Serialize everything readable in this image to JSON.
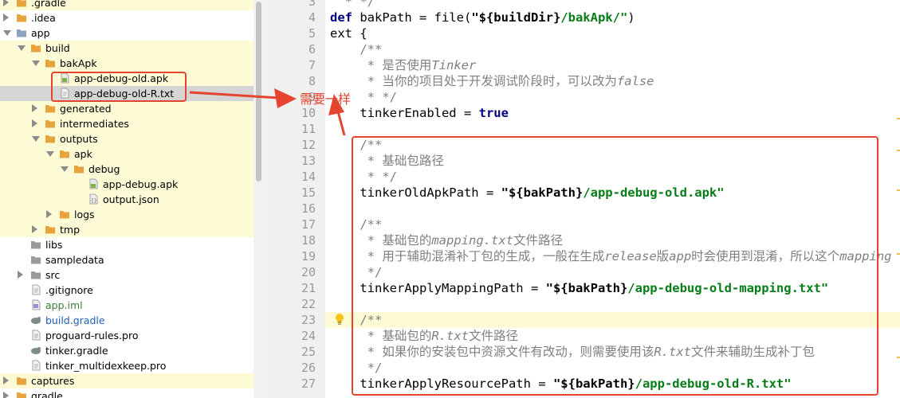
{
  "tree": {
    "items": [
      {
        "label": ".gradle",
        "indent": 0,
        "state": "collapsed",
        "icon": "folder-icon",
        "style": "normal",
        "highlight": true
      },
      {
        "label": ".idea",
        "indent": 0,
        "state": "collapsed",
        "icon": "folder-icon",
        "style": "normal",
        "highlight": false
      },
      {
        "label": "app",
        "indent": 0,
        "state": "expanded",
        "icon": "module-folder-icon",
        "style": "normal",
        "highlight": false
      },
      {
        "label": "build",
        "indent": 1,
        "state": "expanded",
        "icon": "folder-icon",
        "style": "normal",
        "highlight": true
      },
      {
        "label": "bakApk",
        "indent": 2,
        "state": "expanded",
        "icon": "folder-icon",
        "style": "normal",
        "highlight": true
      },
      {
        "label": "app-debug-old.apk",
        "indent": 3,
        "state": "leaf",
        "icon": "apk-file-icon",
        "style": "normal",
        "highlight": true
      },
      {
        "label": "app-debug-old-R.txt",
        "indent": 3,
        "state": "leaf",
        "icon": "text-file-icon",
        "style": "normal",
        "highlight": false,
        "selected": true
      },
      {
        "label": "generated",
        "indent": 2,
        "state": "collapsed",
        "icon": "folder-icon",
        "style": "normal",
        "highlight": true
      },
      {
        "label": "intermediates",
        "indent": 2,
        "state": "collapsed",
        "icon": "folder-icon",
        "style": "normal",
        "highlight": true
      },
      {
        "label": "outputs",
        "indent": 2,
        "state": "expanded",
        "icon": "folder-icon",
        "style": "normal",
        "highlight": true
      },
      {
        "label": "apk",
        "indent": 3,
        "state": "expanded",
        "icon": "folder-icon",
        "style": "normal",
        "highlight": true
      },
      {
        "label": "debug",
        "indent": 4,
        "state": "expanded",
        "icon": "folder-icon",
        "style": "normal",
        "highlight": true
      },
      {
        "label": "app-debug.apk",
        "indent": 5,
        "state": "leaf",
        "icon": "apk-file-icon",
        "style": "normal",
        "highlight": true
      },
      {
        "label": "output.json",
        "indent": 5,
        "state": "leaf",
        "icon": "json-file-icon",
        "style": "normal",
        "highlight": true
      },
      {
        "label": "logs",
        "indent": 3,
        "state": "collapsed",
        "icon": "folder-icon",
        "style": "normal",
        "highlight": true
      },
      {
        "label": "tmp",
        "indent": 2,
        "state": "collapsed",
        "icon": "folder-icon",
        "style": "normal",
        "highlight": true
      },
      {
        "label": "libs",
        "indent": 1,
        "state": "leaf",
        "icon": "gray-folder-icon",
        "style": "normal",
        "highlight": false
      },
      {
        "label": "sampledata",
        "indent": 1,
        "state": "leaf",
        "icon": "gray-folder-icon",
        "style": "normal",
        "highlight": false
      },
      {
        "label": "src",
        "indent": 1,
        "state": "collapsed",
        "icon": "gray-folder-icon",
        "style": "normal",
        "highlight": false
      },
      {
        "label": ".gitignore",
        "indent": 1,
        "state": "leaf",
        "icon": "text-file-icon",
        "style": "normal",
        "highlight": false
      },
      {
        "label": "app.iml",
        "indent": 1,
        "state": "leaf",
        "icon": "iml-file-icon",
        "style": "green",
        "highlight": false
      },
      {
        "label": "build.gradle",
        "indent": 1,
        "state": "leaf",
        "icon": "gradle-icon",
        "style": "blue",
        "highlight": false
      },
      {
        "label": "proguard-rules.pro",
        "indent": 1,
        "state": "leaf",
        "icon": "text-file-icon",
        "style": "normal",
        "highlight": false
      },
      {
        "label": "tinker.gradle",
        "indent": 1,
        "state": "leaf",
        "icon": "gradle-icon",
        "style": "normal",
        "highlight": false
      },
      {
        "label": "tinker_multidexkeep.pro",
        "indent": 1,
        "state": "leaf",
        "icon": "text-file-icon",
        "style": "normal",
        "highlight": false
      },
      {
        "label": "captures",
        "indent": 0,
        "state": "collapsed",
        "icon": "folder-icon",
        "style": "normal",
        "highlight": true
      },
      {
        "label": "gradle",
        "indent": 0,
        "state": "collapsed",
        "icon": "folder-icon",
        "style": "normal",
        "highlight": false
      }
    ]
  },
  "editor": {
    "current_line": "23",
    "lines": [
      {
        "n": "3",
        "segs": [
          {
            "t": "  * */",
            "c": "cm"
          }
        ]
      },
      {
        "n": "4",
        "segs": [
          {
            "t": "def",
            "c": "kw"
          },
          {
            "t": " bakPath = file(",
            "c": ""
          },
          {
            "t": "\"${buildDir}/bakApk/\"",
            "c": "mix1"
          },
          {
            "t": ")",
            "c": ""
          }
        ]
      },
      {
        "n": "5",
        "segs": [
          {
            "t": "ext {",
            "c": ""
          }
        ]
      },
      {
        "n": "6",
        "segs": [
          {
            "t": "    /**",
            "c": "cm"
          }
        ]
      },
      {
        "n": "7",
        "segs": [
          {
            "t": "     * 是否使用",
            "c": "cm"
          },
          {
            "t": "Tinker",
            "c": "cmi"
          }
        ]
      },
      {
        "n": "8",
        "segs": [
          {
            "t": "     * 当你的项目处于开发调试阶段时，可以改为",
            "c": "cm"
          },
          {
            "t": "false",
            "c": "cmi"
          }
        ]
      },
      {
        "n": "9",
        "segs": [
          {
            "t": "     * */",
            "c": "cm"
          }
        ]
      },
      {
        "n": "10",
        "segs": [
          {
            "t": "    tinkerEnabled = ",
            "c": ""
          },
          {
            "t": "true",
            "c": "kw"
          }
        ]
      },
      {
        "n": "11",
        "segs": [
          {
            "t": "",
            "c": ""
          }
        ]
      },
      {
        "n": "12",
        "segs": [
          {
            "t": "    /**",
            "c": "cm"
          }
        ]
      },
      {
        "n": "13",
        "segs": [
          {
            "t": "     * 基础包路径",
            "c": "cm"
          }
        ]
      },
      {
        "n": "14",
        "segs": [
          {
            "t": "     * */",
            "c": "cm"
          }
        ]
      },
      {
        "n": "15",
        "segs": [
          {
            "t": "    tinkerOldApkPath = ",
            "c": ""
          },
          {
            "t": "\"${bakPath}",
            "c": "b"
          },
          {
            "t": "/app-debug-old.apk\"",
            "c": "str"
          }
        ]
      },
      {
        "n": "16",
        "segs": [
          {
            "t": "",
            "c": ""
          }
        ]
      },
      {
        "n": "17",
        "segs": [
          {
            "t": "    /**",
            "c": "cm"
          }
        ]
      },
      {
        "n": "18",
        "segs": [
          {
            "t": "     * 基础包的",
            "c": "cm"
          },
          {
            "t": "mapping.txt",
            "c": "cmi"
          },
          {
            "t": "文件路径",
            "c": "cm"
          }
        ]
      },
      {
        "n": "19",
        "segs": [
          {
            "t": "     * 用于辅助混淆补丁包的生成，一般在生成",
            "c": "cm"
          },
          {
            "t": "release",
            "c": "cmi"
          },
          {
            "t": "版",
            "c": "cm"
          },
          {
            "t": "app",
            "c": "cmi"
          },
          {
            "t": "时会使用到混淆，所以这个",
            "c": "cm"
          },
          {
            "t": "mapping",
            "c": "cmi"
          }
        ]
      },
      {
        "n": "20",
        "segs": [
          {
            "t": "     */",
            "c": "cm"
          }
        ]
      },
      {
        "n": "21",
        "segs": [
          {
            "t": "    tinkerApplyMappingPath = ",
            "c": ""
          },
          {
            "t": "\"${bakPath}",
            "c": "b"
          },
          {
            "t": "/app-debug-old-mapping.txt\"",
            "c": "str"
          }
        ]
      },
      {
        "n": "22",
        "segs": [
          {
            "t": "",
            "c": ""
          }
        ]
      },
      {
        "n": "23",
        "segs": [
          {
            "t": "    /**",
            "c": "cm"
          }
        ]
      },
      {
        "n": "24",
        "segs": [
          {
            "t": "     * 基础包的",
            "c": "cm"
          },
          {
            "t": "R.txt",
            "c": "cmi"
          },
          {
            "t": "文件路径",
            "c": "cm"
          }
        ]
      },
      {
        "n": "25",
        "segs": [
          {
            "t": "     * 如果你的安装包中资源文件有改动，则需要使用该",
            "c": "cm"
          },
          {
            "t": "R.txt",
            "c": "cmi"
          },
          {
            "t": "文件来辅助生成补丁包",
            "c": "cm"
          }
        ]
      },
      {
        "n": "26",
        "segs": [
          {
            "t": "     */",
            "c": "cm"
          }
        ]
      },
      {
        "n": "27",
        "segs": [
          {
            "t": "    tinkerApplyResourcePath = ",
            "c": ""
          },
          {
            "t": "\"${bakPath}",
            "c": "b"
          },
          {
            "t": "/app-debug-old-R.txt\"",
            "c": "str"
          }
        ]
      }
    ]
  },
  "annotation": {
    "note": "需要一样",
    "color": "#e5452f"
  },
  "colors": {
    "keyword": "#000080",
    "string": "#067d17",
    "comment": "#808080",
    "highlight": "#fdfbd6",
    "folder": "#e8a33d"
  }
}
